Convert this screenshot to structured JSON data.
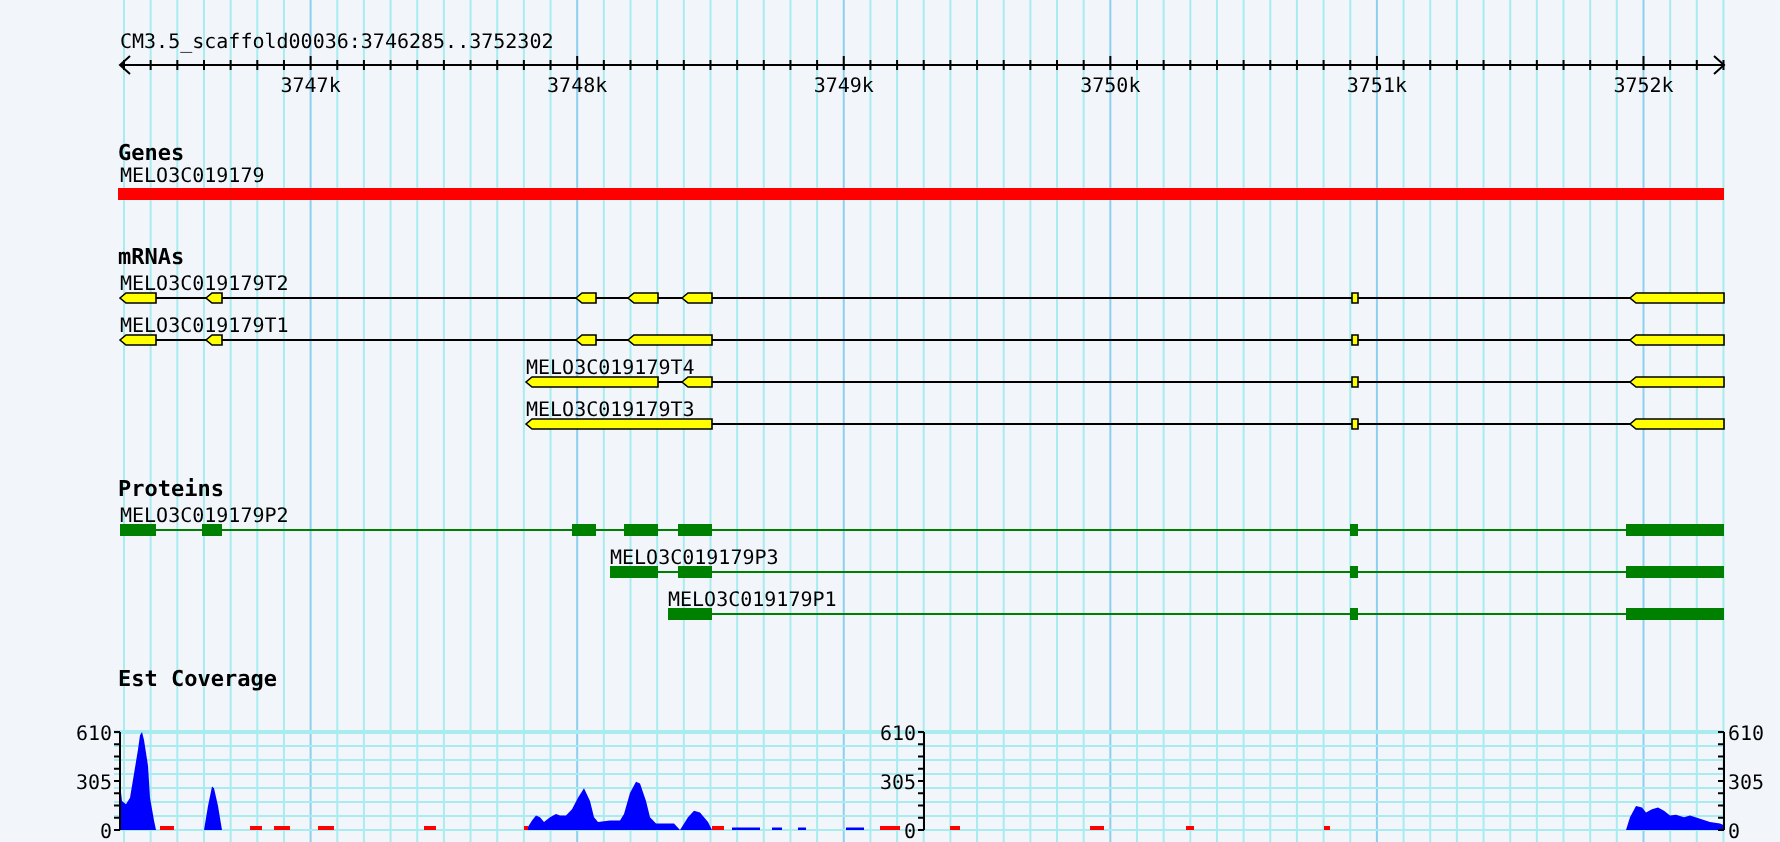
{
  "ruler": {
    "title": "CM3.5_scaffold00036:3746285..3752302",
    "labels": [
      "3747k",
      "3748k",
      "3749k",
      "3750k",
      "3751k",
      "3752k"
    ]
  },
  "tracks": [
    {
      "kind": "gene",
      "title": "Genes",
      "features": [
        {
          "label": "MELO3C019179"
        }
      ]
    },
    {
      "kind": "mrna",
      "title": "mRNAs",
      "features": [
        {
          "label": "MELO3C019179T2"
        },
        {
          "label": "MELO3C019179T1"
        },
        {
          "label": "MELO3C019179T4"
        },
        {
          "label": "MELO3C019179T3"
        }
      ]
    },
    {
      "kind": "protein",
      "title": "Proteins",
      "features": [
        {
          "label": "MELO3C019179P2"
        },
        {
          "label": "MELO3C019179P3"
        },
        {
          "label": "MELO3C019179P1"
        }
      ]
    },
    {
      "kind": "coverage",
      "title": "Est Coverage",
      "scales": [
        {
          "ticks": [
            "610",
            "305",
            "0"
          ]
        },
        {
          "ticks": [
            "610",
            "305",
            "0"
          ]
        },
        {
          "ticks": [
            "610",
            "305",
            "0"
          ]
        }
      ]
    }
  ]
}
